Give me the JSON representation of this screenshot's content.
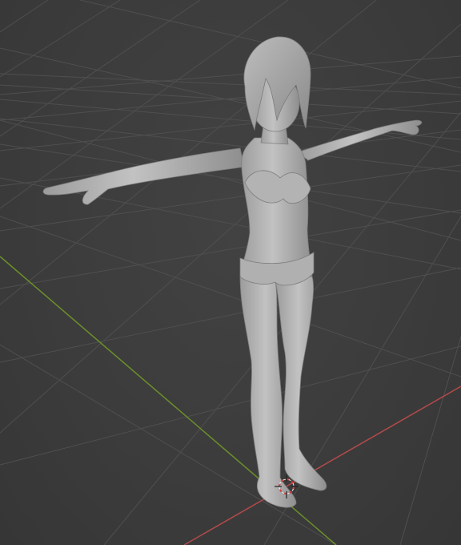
{
  "viewport": {
    "background": "#3d3d3d",
    "grid_color": "#505050",
    "x_axis_color": "#b34a4a",
    "y_axis_color": "#6b8f2a",
    "mesh_color": "#b9b9b9",
    "cursor_color": "#d04040"
  },
  "scene_object": {
    "icon": "character-mesh-icon",
    "pose": "T-pose",
    "shading": "solid"
  },
  "cursor": {
    "icon": "3d-cursor-icon"
  }
}
